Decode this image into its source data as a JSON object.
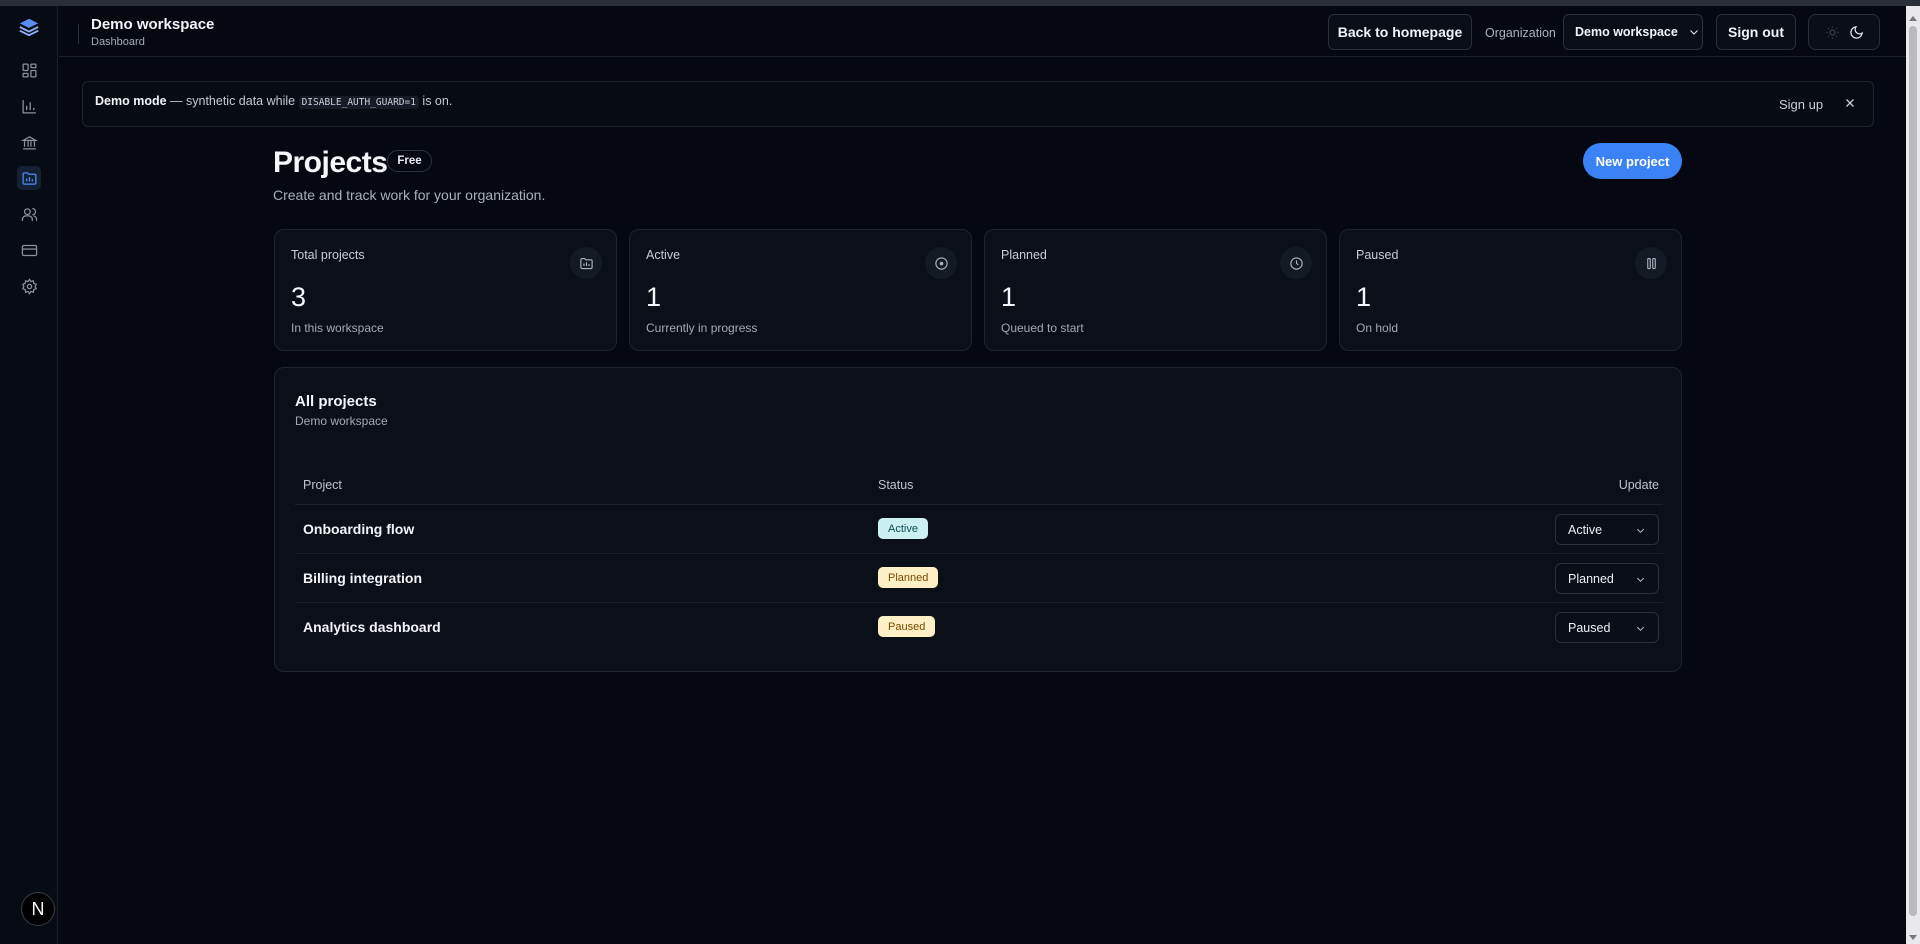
{
  "header": {
    "title": "Demo workspace",
    "subtitle": "Dashboard",
    "back_label": "Back to homepage",
    "org_label": "Organization",
    "org_value": "Demo workspace",
    "signout_label": "Sign out"
  },
  "sidebar": {
    "items": [
      {
        "icon": "dashboard-icon"
      },
      {
        "icon": "bar-chart-icon"
      },
      {
        "icon": "bank-icon"
      },
      {
        "icon": "projects-icon",
        "active": true
      },
      {
        "icon": "users-icon"
      },
      {
        "icon": "credit-card-icon"
      },
      {
        "icon": "gear-icon"
      }
    ],
    "avatar_letter": "N"
  },
  "banner": {
    "bold": "Demo mode",
    "text_before": " — synthetic data while ",
    "code": "DISABLE_AUTH_GUARD=1",
    "text_after": " is on.",
    "signup_label": "Sign up"
  },
  "page": {
    "title": "Projects",
    "plan": "Free",
    "subtitle": "Create and track work for your organization.",
    "new_project_label": "New project"
  },
  "stats": [
    {
      "label": "Total projects",
      "value": "3",
      "sub": "In this workspace",
      "icon": "folder-icon"
    },
    {
      "label": "Active",
      "value": "1",
      "sub": "Currently in progress",
      "icon": "target-icon"
    },
    {
      "label": "Planned",
      "value": "1",
      "sub": "Queued to start",
      "icon": "clock-icon"
    },
    {
      "label": "Paused",
      "value": "1",
      "sub": "On hold",
      "icon": "pause-icon"
    }
  ],
  "projects": {
    "title": "All projects",
    "subtitle": "Demo workspace",
    "columns": [
      "Project",
      "Status",
      "Update"
    ],
    "rows": [
      {
        "name": "Onboarding flow",
        "status": "Active",
        "select": "Active"
      },
      {
        "name": "Billing integration",
        "status": "Planned",
        "select": "Planned"
      },
      {
        "name": "Analytics dashboard",
        "status": "Paused",
        "select": "Paused"
      }
    ]
  },
  "colors": {
    "accent": "#3b82f6",
    "active_pill_bg": "#cceff0",
    "active_pill_fg": "#0f4f55",
    "planned_pill_bg": "#fdf0c4",
    "planned_pill_fg": "#7a4a00",
    "paused_pill_bg": "#fdf0c4",
    "paused_pill_fg": "#7a4a00"
  }
}
